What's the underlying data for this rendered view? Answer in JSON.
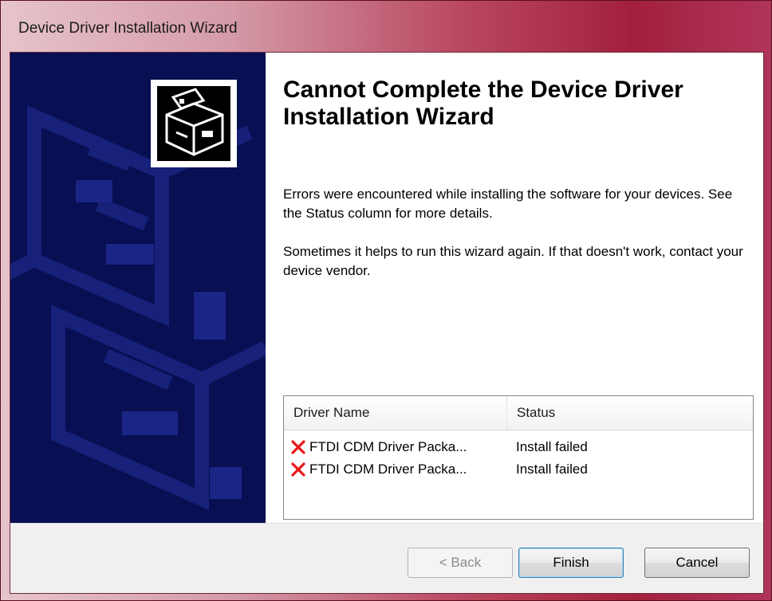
{
  "window": {
    "title": "Device Driver Installation Wizard"
  },
  "main": {
    "heading": "Cannot Complete the Device Driver Installation Wizard",
    "paragraph1": "Errors were encountered while installing the software for your devices. See the Status column for more details.",
    "paragraph2": "Sometimes it helps to run this wizard again. If that doesn't work, contact your device vendor."
  },
  "driver_table": {
    "columns": [
      "Driver Name",
      "Status"
    ],
    "rows": [
      {
        "name": "FTDI CDM Driver Packa...",
        "status": "Install failed",
        "icon": "red-x-icon"
      },
      {
        "name": "FTDI CDM Driver Packa...",
        "status": "Install failed",
        "icon": "red-x-icon"
      }
    ]
  },
  "buttons": {
    "back": "< Back",
    "finish": "Finish",
    "cancel": "Cancel"
  },
  "colors": {
    "banner": "#080f52",
    "error": "#e81818",
    "title_bar": "#a2203d"
  }
}
